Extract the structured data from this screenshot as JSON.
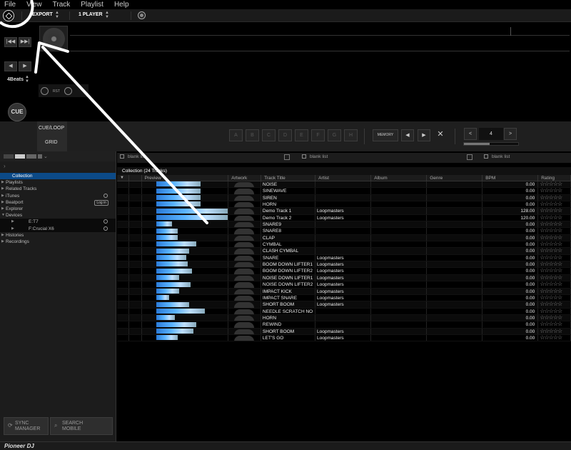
{
  "menubar": {
    "items": [
      "File",
      "View",
      "Track",
      "Playlist",
      "Help"
    ]
  },
  "toolbar": {
    "mode": "EXPORT",
    "players": "1 PLAYER"
  },
  "player": {
    "prev_label": "|◀◀",
    "next_label": "▶▶|",
    "beat_back": "◀",
    "beat_fwd": "▶",
    "beat_jump": "4Beats",
    "rst_label": "RST",
    "cue_label": "CUE",
    "play_label": "▶"
  },
  "cuebar": {
    "cueloop_label": "CUE/LOOP",
    "grid_label": "GRID",
    "hot_cues": [
      "A",
      "B",
      "C",
      "D",
      "E",
      "F",
      "G",
      "H"
    ],
    "memory_label": "MEMORY",
    "loop_value": "4",
    "loop_slider_fraction": 0.47
  },
  "tree": {
    "items": [
      {
        "label": "Collection",
        "selected": true
      },
      {
        "label": "Playlists"
      },
      {
        "label": "Related Tracks"
      },
      {
        "label": "iTunes"
      },
      {
        "label": "Beatport",
        "badge": "Log in"
      },
      {
        "label": "Explorer"
      },
      {
        "label": "Devices",
        "expanded": true
      },
      {
        "label": "E:T7",
        "sub": true
      },
      {
        "label": "F:Crucial X6",
        "sub": true
      },
      {
        "label": "Histories"
      },
      {
        "label": "Recordings"
      }
    ],
    "sync_label_1": "SYNC",
    "sync_label_2": "MANAGER",
    "search_label_1": "SEARCH",
    "search_label_2": "MOBILE"
  },
  "lists": {
    "blank_list": "blank list"
  },
  "collection": {
    "title": "Collection (24 Tracks)",
    "columns": [
      "",
      "",
      "Preview",
      "Artwork",
      "Track Title",
      "Artist",
      "Album",
      "Genre",
      "BPM",
      "Rating"
    ],
    "tracks": [
      {
        "title": "NOISE",
        "artist": "",
        "bpm": "0.00"
      },
      {
        "title": "SINEWAVE",
        "artist": "",
        "bpm": "0.00"
      },
      {
        "title": "SIREN",
        "artist": "",
        "bpm": "0.00"
      },
      {
        "title": "HORN",
        "artist": "",
        "bpm": "0.00"
      },
      {
        "title": "Demo Track 1",
        "artist": "Loopmasters",
        "bpm": "128.00"
      },
      {
        "title": "Demo Track 2",
        "artist": "Loopmasters",
        "bpm": "120.00"
      },
      {
        "title": "SNARE9",
        "artist": "",
        "bpm": "0.00"
      },
      {
        "title": "SNARE8",
        "artist": "",
        "bpm": "0.00"
      },
      {
        "title": "CLAP",
        "artist": "",
        "bpm": "0.00"
      },
      {
        "title": "CYMBAL",
        "artist": "",
        "bpm": "0.00"
      },
      {
        "title": "CLASH CYMBAL",
        "artist": "",
        "bpm": "0.00"
      },
      {
        "title": "SNARE",
        "artist": "Loopmasters",
        "bpm": "0.00"
      },
      {
        "title": "BOOM DOWN LIFTER1",
        "artist": "Loopmasters",
        "bpm": "0.00"
      },
      {
        "title": "BOOM DOWN LIFTER2",
        "artist": "Loopmasters",
        "bpm": "0.00"
      },
      {
        "title": "NOISE DOWN LIFTER1",
        "artist": "Loopmasters",
        "bpm": "0.00"
      },
      {
        "title": "NOISE DOWN LIFTER2",
        "artist": "Loopmasters",
        "bpm": "0.00"
      },
      {
        "title": "IMPACT KICK",
        "artist": "Loopmasters",
        "bpm": "0.00"
      },
      {
        "title": "IMPACT SNARE",
        "artist": "Loopmasters",
        "bpm": "0.00"
      },
      {
        "title": "SHORT BOOM",
        "artist": "Loopmasters",
        "bpm": "0.00"
      },
      {
        "title": "NEEDLE SCRATCH NO",
        "artist": "",
        "bpm": "0.00"
      },
      {
        "title": "HORN",
        "artist": "",
        "bpm": "0.00"
      },
      {
        "title": "REWIND",
        "artist": "",
        "bpm": "0.00"
      },
      {
        "title": "SHORT BOOM",
        "artist": "Loopmasters",
        "bpm": "0.00"
      },
      {
        "title": "LET'S GO",
        "artist": "Loopmasters",
        "bpm": "0.00"
      }
    ],
    "rating_stars": "☆☆☆☆☆"
  },
  "footer": {
    "brand": "Pioneer DJ"
  },
  "colors": {
    "selected": "#0c4a88",
    "waveform": "#2a7bd8",
    "background": "#000000"
  }
}
